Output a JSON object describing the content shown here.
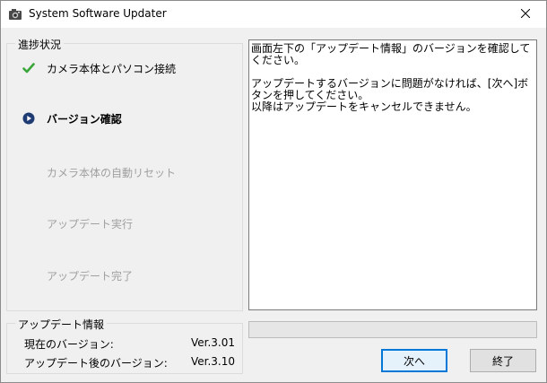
{
  "window": {
    "title": "System Software Updater",
    "app_icon": "camera-app-icon",
    "close_icon": "close-icon"
  },
  "progress": {
    "legend": "進捗状況",
    "steps": [
      {
        "label": "カメラ本体とパソコン接続",
        "state": "done",
        "icon": "checkmark-icon"
      },
      {
        "label": "バージョン確認",
        "state": "current",
        "icon": "current-step-arrow-icon"
      },
      {
        "label": "カメラ本体の自動リセット",
        "state": "pending"
      },
      {
        "label": "アップデート実行",
        "state": "pending"
      },
      {
        "label": "アップデート完了",
        "state": "pending"
      }
    ]
  },
  "message": {
    "line1": "画面左下の「アップデート情報」のバージョンを確認してください。",
    "line2": "アップデートするバージョンに問題がなければ、[次へ]ボタンを押してください。",
    "line3": "以降はアップデートをキャンセルできません。"
  },
  "progress_bar": {
    "value": 0
  },
  "update_info": {
    "legend": "アップデート情報",
    "current_label": "現在のバージョン:",
    "current_value": "Ver.3.01",
    "after_label": "アップデート後のバージョン:",
    "after_value": "Ver.3.10"
  },
  "buttons": {
    "next": "次へ",
    "finish": "終了"
  },
  "colors": {
    "check_green": "#3aa63a",
    "current_blue": "#1f3b73",
    "pending_gray": "#a0a0a0",
    "default_button_border": "#0078d7"
  }
}
